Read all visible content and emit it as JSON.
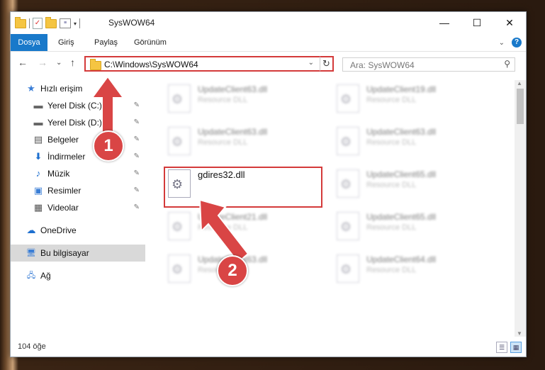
{
  "window": {
    "title": "SysWOW64",
    "minimize": "—",
    "maximize": "☐",
    "close": "✕"
  },
  "ribbon": {
    "tabs": [
      "Dosya",
      "Giriş",
      "Paylaş",
      "Görünüm"
    ],
    "expand": "⌄",
    "help": "?"
  },
  "address": {
    "path": "C:\\Windows\\SysWOW64",
    "dropdown": "⌄",
    "refresh": "↻"
  },
  "search": {
    "placeholder": "Ara: SysWOW64",
    "icon": "magnifier-icon"
  },
  "nav": {
    "back": "←",
    "forward": "→",
    "recent": "⌄",
    "up": "↑"
  },
  "sidebar": {
    "items": [
      {
        "label": "Hızlı erişim",
        "icon": "star-icon",
        "glyph": "★"
      },
      {
        "label": "Yerel Disk (C:)",
        "icon": "disk-icon",
        "glyph": "▬",
        "pin": "📌"
      },
      {
        "label": "Yerel Disk (D:)",
        "icon": "disk-icon",
        "glyph": "▬",
        "pin": "📌"
      },
      {
        "label": "Belgeler",
        "icon": "document-icon",
        "glyph": "▤",
        "pin": "📌"
      },
      {
        "label": "İndirmeler",
        "icon": "download-icon",
        "glyph": "⬇",
        "pin": "📌"
      },
      {
        "label": "Müzik",
        "icon": "music-icon",
        "glyph": "♪",
        "pin": "📌"
      },
      {
        "label": "Resimler",
        "icon": "pictures-icon",
        "glyph": "▣",
        "pin": "📌"
      },
      {
        "label": "Videolar",
        "icon": "video-icon",
        "glyph": "▦",
        "pin": "📌"
      },
      {
        "label": "OneDrive",
        "icon": "cloud-icon",
        "glyph": "☁"
      },
      {
        "label": "Bu bilgisayar",
        "icon": "computer-icon",
        "glyph": "🖥"
      },
      {
        "label": "Ağ",
        "icon": "network-icon",
        "glyph": "🖧"
      }
    ]
  },
  "files": [
    {
      "name": "UpdateClient63.dll",
      "type": "Resource DLL"
    },
    {
      "name": "UpdateClient19.dll",
      "type": "Resource DLL"
    },
    {
      "name": "UpdateClient63.dll",
      "type": "Resource DLL"
    },
    {
      "name": "UpdateClient63.dll",
      "type": "Resource DLL"
    },
    {
      "name": "gdires32.dll",
      "type": ""
    },
    {
      "name": "UpdateClient65.dll",
      "type": "Resource DLL"
    },
    {
      "name": "UpdateClient21.dll",
      "type": "Resource DLL"
    },
    {
      "name": "UpdateClient65.dll",
      "type": "Resource DLL"
    },
    {
      "name": "UpdateClient63.dll",
      "type": "Resource DLL"
    },
    {
      "name": "UpdateClient64.dll",
      "type": "Resource DLL"
    }
  ],
  "status": {
    "count": "104 öğe"
  },
  "annotations": {
    "step1": "1",
    "step2": "2",
    "color": "#d94545"
  }
}
